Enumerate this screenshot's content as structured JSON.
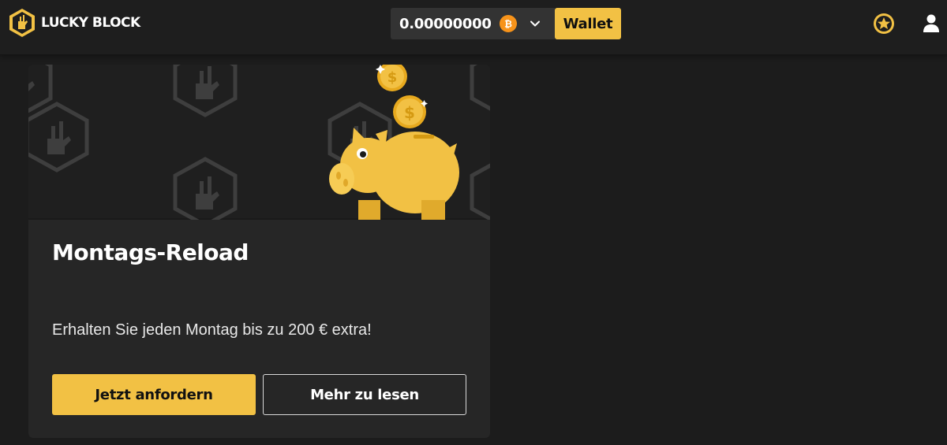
{
  "header": {
    "brand": "LUCKY BLOCK",
    "balance": "0.00000000",
    "currency_icon": "bitcoin-icon",
    "wallet_label": "Wallet",
    "accent": "#f2c144",
    "bitcoin_color": "#f7931a"
  },
  "promo": {
    "title": "Montags-Reload",
    "description": "Erhalten Sie jeden Montag bis zu 200 € extra!",
    "primary_button": "Jetzt anfordern",
    "secondary_button": "Mehr zu lesen",
    "hero_icon": "piggy-bank-with-coins",
    "background_color": "#262626"
  },
  "icons": {
    "rewards": "star-badge-icon",
    "account": "user-icon"
  }
}
